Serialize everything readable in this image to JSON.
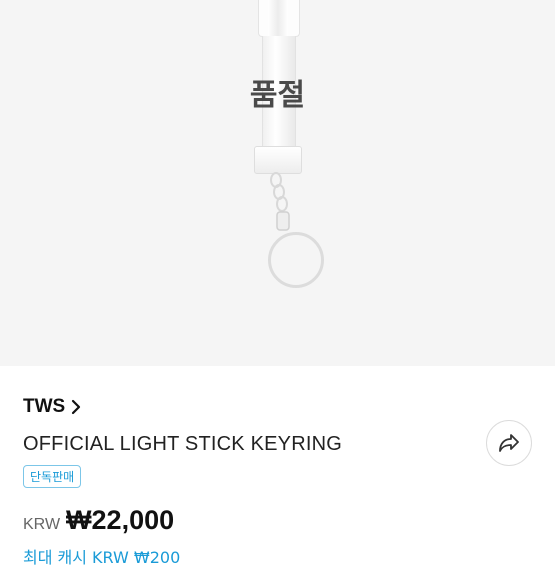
{
  "product": {
    "sold_out_label": "품절",
    "artist": "TWS",
    "title": "OFFICIAL LIGHT STICK KEYRING",
    "badge": "단독판매",
    "currency": "KRW",
    "price": "₩22,000",
    "cashback": "최대 캐시 KRW ₩200"
  },
  "icons": {
    "artist_chevron": "chevron-right-icon",
    "share": "share-icon"
  },
  "colors": {
    "accent": "#1a9bd7",
    "badge_border": "#7cc6e8",
    "hero_bg": "#f5f5f5"
  }
}
